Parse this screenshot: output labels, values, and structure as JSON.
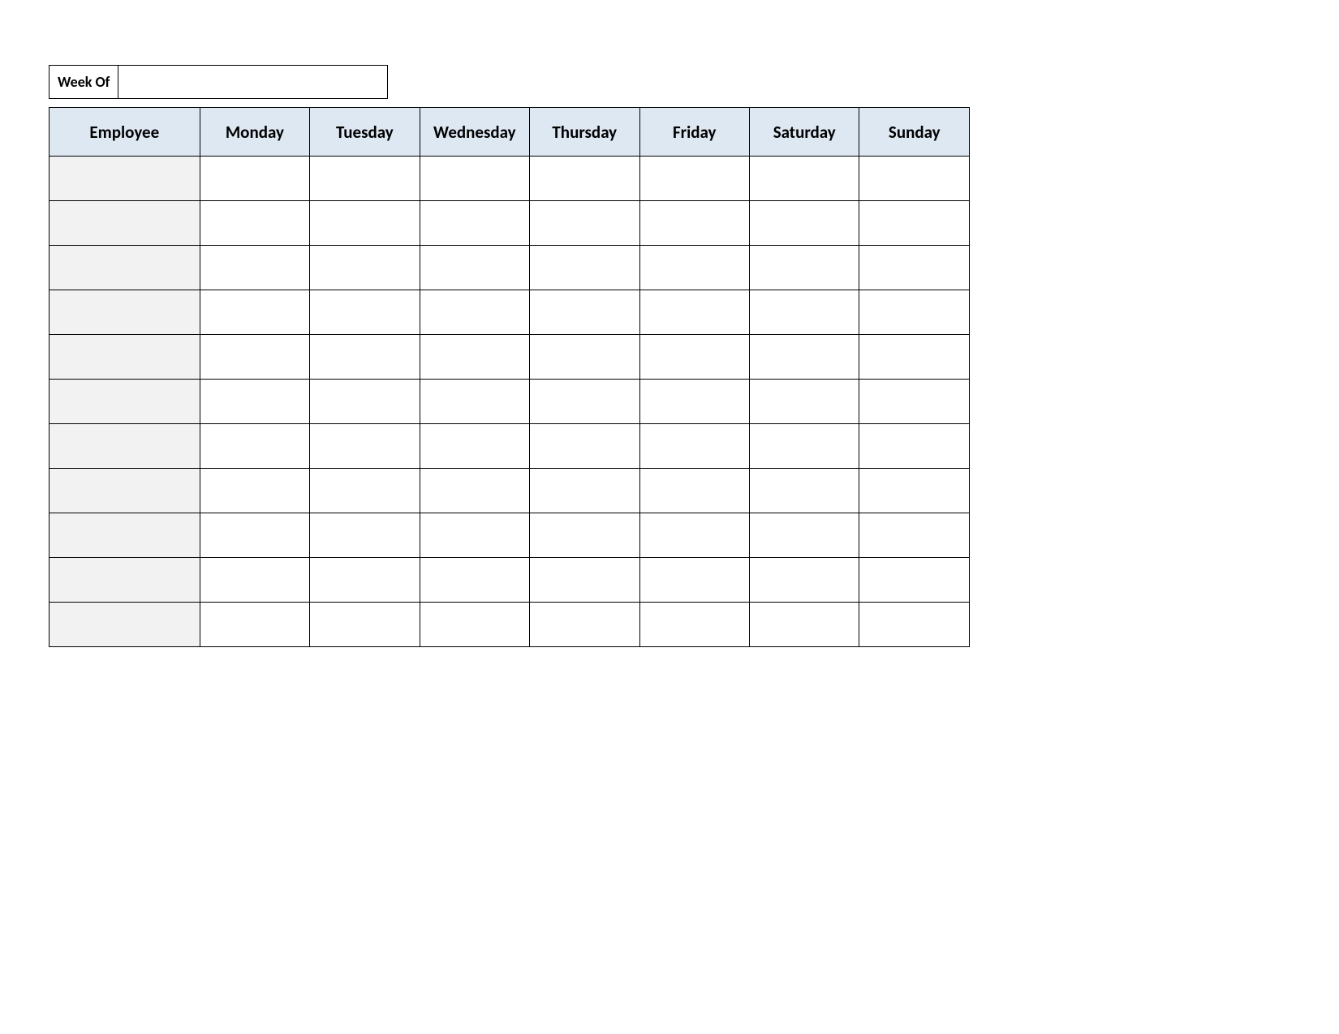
{
  "week_of": {
    "label": "Week Of",
    "value": ""
  },
  "table": {
    "headers": [
      "Employee",
      "Monday",
      "Tuesday",
      "Wednesday",
      "Thursday",
      "Friday",
      "Saturday",
      "Sunday"
    ],
    "rows": [
      {
        "employee": "",
        "days": [
          "",
          "",
          "",
          "",
          "",
          "",
          ""
        ]
      },
      {
        "employee": "",
        "days": [
          "",
          "",
          "",
          "",
          "",
          "",
          ""
        ]
      },
      {
        "employee": "",
        "days": [
          "",
          "",
          "",
          "",
          "",
          "",
          ""
        ]
      },
      {
        "employee": "",
        "days": [
          "",
          "",
          "",
          "",
          "",
          "",
          ""
        ]
      },
      {
        "employee": "",
        "days": [
          "",
          "",
          "",
          "",
          "",
          "",
          ""
        ]
      },
      {
        "employee": "",
        "days": [
          "",
          "",
          "",
          "",
          "",
          "",
          ""
        ]
      },
      {
        "employee": "",
        "days": [
          "",
          "",
          "",
          "",
          "",
          "",
          ""
        ]
      },
      {
        "employee": "",
        "days": [
          "",
          "",
          "",
          "",
          "",
          "",
          ""
        ]
      },
      {
        "employee": "",
        "days": [
          "",
          "",
          "",
          "",
          "",
          "",
          ""
        ]
      },
      {
        "employee": "",
        "days": [
          "",
          "",
          "",
          "",
          "",
          "",
          ""
        ]
      },
      {
        "employee": "",
        "days": [
          "",
          "",
          "",
          "",
          "",
          "",
          ""
        ]
      }
    ]
  }
}
